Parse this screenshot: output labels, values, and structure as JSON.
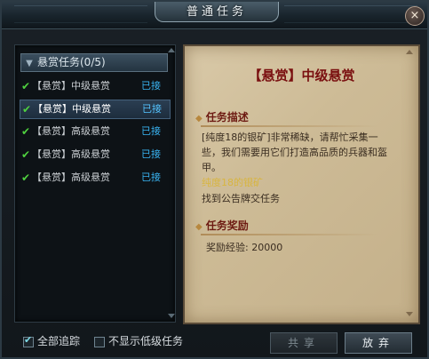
{
  "window": {
    "title": "普通任务",
    "close_symbol": "×"
  },
  "quest_list": {
    "category": "悬赏任务(0/5)",
    "items": [
      {
        "name": "【悬赏】中级悬赏",
        "state": "已接",
        "selected": false
      },
      {
        "name": "【悬赏】中级悬赏",
        "state": "已接",
        "selected": true
      },
      {
        "name": "【悬赏】高级悬赏",
        "state": "已接",
        "selected": false
      },
      {
        "name": "【悬赏】高级悬赏",
        "state": "已接",
        "selected": false
      },
      {
        "name": "【悬赏】高级悬赏",
        "state": "已接",
        "selected": false
      }
    ]
  },
  "detail": {
    "title": "【悬赏】中级悬赏",
    "desc_heading": "任务描述",
    "desc_line1": "[纯度18的银矿]非常稀缺，请帮忙采集一",
    "desc_line2": "些，我们需要用它们打造高品质的兵器和盔",
    "desc_line3": "甲。",
    "target_item": "纯度18的银矿",
    "target_hint": "找到公告牌交任务",
    "reward_heading": "任务奖励",
    "reward_text": "奖励经验: 20000"
  },
  "footer": {
    "track_all_label": "全部追踪",
    "track_all_checked": true,
    "hide_low_label": "不显示低级任务",
    "hide_low_checked": false,
    "share_label": "共享",
    "abandon_label": "放弃"
  },
  "colors": {
    "accept_state": "#39b4f2",
    "detail_title": "#7a1010",
    "target_item": "#d8b540",
    "check": "#4fd03f"
  }
}
